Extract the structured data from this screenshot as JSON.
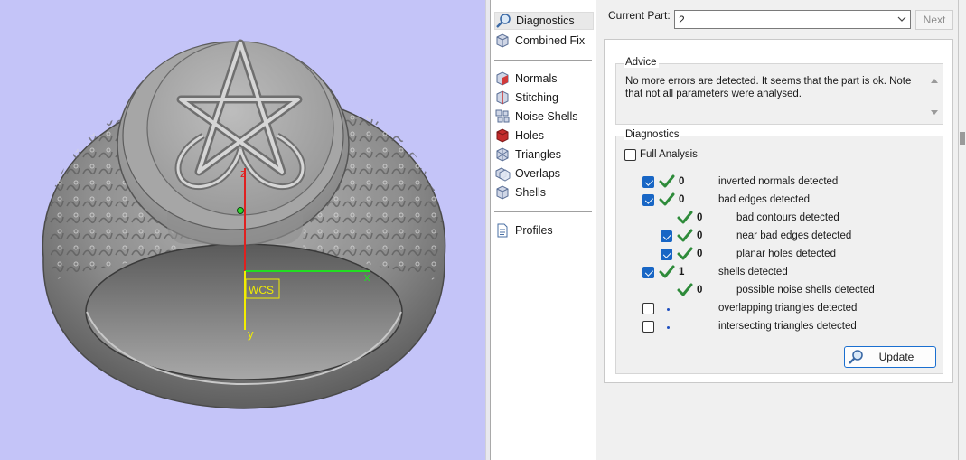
{
  "viewport": {
    "axis_labels": {
      "z": "z",
      "x": "x",
      "y": "y",
      "wcs": "WCS"
    },
    "colors": {
      "background": "#c4c4f8",
      "x_axis": "#22dd22",
      "z_axis": "#e02020",
      "y_axis": "#f2ee00"
    }
  },
  "nav": {
    "items": [
      {
        "label": "Diagnostics",
        "icon": "magnifier-icon",
        "selected": true
      },
      {
        "label": "Combined Fix",
        "icon": "cube-icon"
      },
      {
        "label": "Normals",
        "icon": "normals-cube-icon"
      },
      {
        "label": "Stitching",
        "icon": "stitching-cube-icon"
      },
      {
        "label": "Noise Shells",
        "icon": "noise-shells-icon"
      },
      {
        "label": "Holes",
        "icon": "holes-cube-icon"
      },
      {
        "label": "Triangles",
        "icon": "triangles-icon"
      },
      {
        "label": "Overlaps",
        "icon": "overlaps-icon"
      },
      {
        "label": "Shells",
        "icon": "shells-icon"
      },
      {
        "label": "Profiles",
        "icon": "document-icon"
      }
    ]
  },
  "panel": {
    "current_part_label": "Current Part:",
    "current_part_value": "2",
    "next_label": "Next",
    "advice_title": "Advice",
    "advice_text": "No more errors are detected. It seems that the part is ok. Note that not all parameters were analysed.",
    "diagnostics_title": "Diagnostics",
    "full_analysis_label": "Full Analysis",
    "full_analysis_checked": false,
    "rows": [
      {
        "checked": true,
        "has_checkbox": true,
        "status": "ok",
        "count": "0",
        "label": "inverted normals detected",
        "level": 0
      },
      {
        "checked": true,
        "has_checkbox": true,
        "status": "ok",
        "count": "0",
        "label": "bad edges detected",
        "level": 0
      },
      {
        "checked": false,
        "has_checkbox": false,
        "status": "ok",
        "count": "0",
        "label": "bad contours detected",
        "level": 1
      },
      {
        "checked": true,
        "has_checkbox": true,
        "status": "ok",
        "count": "0",
        "label": "near bad edges detected",
        "level": 1
      },
      {
        "checked": true,
        "has_checkbox": true,
        "status": "ok",
        "count": "0",
        "label": "planar holes detected",
        "level": 1
      },
      {
        "checked": true,
        "has_checkbox": true,
        "status": "ok",
        "count": "1",
        "label": "shells detected",
        "level": 0
      },
      {
        "checked": false,
        "has_checkbox": false,
        "status": "ok",
        "count": "0",
        "label": "possible noise shells detected",
        "level": 1
      },
      {
        "checked": false,
        "has_checkbox": true,
        "status": "pending",
        "count": "",
        "label": "overlapping triangles detected",
        "level": 0
      },
      {
        "checked": false,
        "has_checkbox": true,
        "status": "pending",
        "count": "",
        "label": "intersecting triangles detected",
        "level": 0
      }
    ],
    "update_label": "Update",
    "colors": {
      "accent": "#1866c5",
      "ok_tick": "#2e8b3a",
      "pending_dot": "#1f4fbf"
    }
  }
}
